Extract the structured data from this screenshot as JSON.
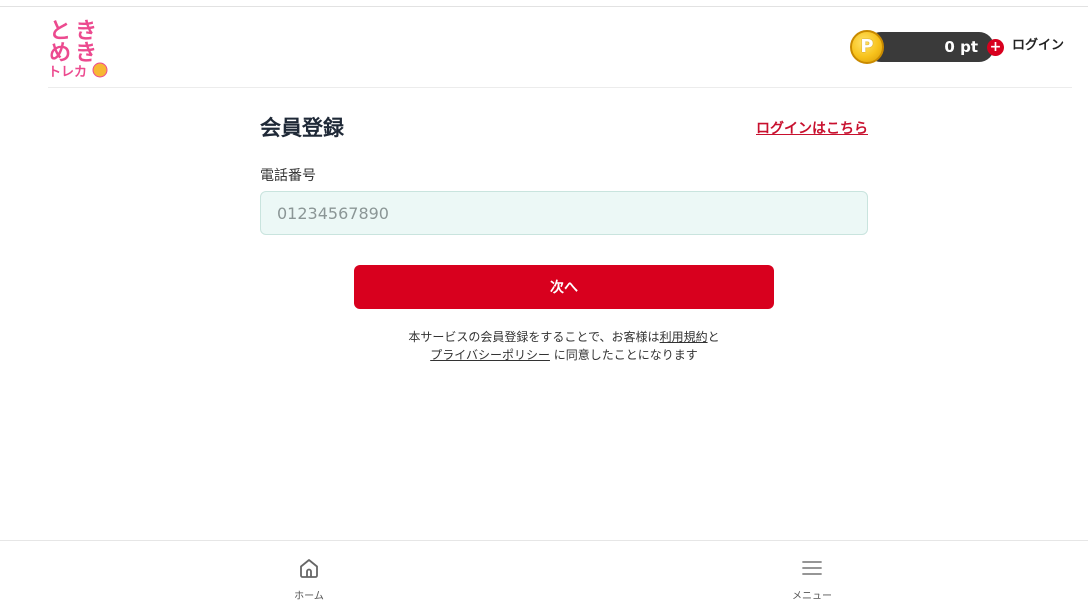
{
  "header": {
    "logo_text": "ときめきトレカ",
    "points_value": "0 pt",
    "coin_letter": "P",
    "plus": "+",
    "login_label": "ログイン"
  },
  "form": {
    "title": "会員登録",
    "login_link": "ログインはこちら",
    "phone_label": "電話番号",
    "phone_placeholder": "01234567890",
    "phone_value": "",
    "next_button": "次へ",
    "terms_prefix": "本サービスの会員登録をすることで、お客様は",
    "terms_link": "利用規約",
    "terms_and": "と",
    "privacy_link": "プライバシーポリシー",
    "terms_suffix": " に同意したことになります"
  },
  "bottom_nav": {
    "items": [
      {
        "label": "ホーム",
        "icon": "home-icon"
      },
      {
        "label": "メニュー",
        "icon": "menu-icon"
      }
    ]
  },
  "colors": {
    "accent": "#d8001e",
    "input_bg": "#ecf8f6",
    "points_pill": "#3a3a3a",
    "coin": "#f7c21b"
  }
}
